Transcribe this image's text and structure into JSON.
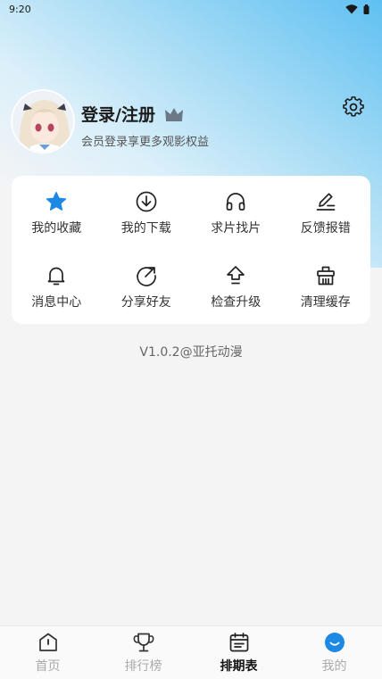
{
  "status_bar": {
    "time": "9:20"
  },
  "profile": {
    "title": "登录/注册",
    "subtitle": "会员登录享更多观影权益"
  },
  "grid": [
    {
      "label": "我的收藏",
      "icon": "star-icon"
    },
    {
      "label": "我的下载",
      "icon": "download-icon"
    },
    {
      "label": "求片找片",
      "icon": "headphones-icon"
    },
    {
      "label": "反馈报错",
      "icon": "edit-icon"
    },
    {
      "label": "消息中心",
      "icon": "bell-icon"
    },
    {
      "label": "分享好友",
      "icon": "share-icon"
    },
    {
      "label": "检查升级",
      "icon": "upgrade-icon"
    },
    {
      "label": "清理缓存",
      "icon": "basket-icon"
    }
  ],
  "version": "V1.0.2@亚托动漫",
  "tabs": [
    {
      "label": "首页",
      "icon": "home-icon"
    },
    {
      "label": "排行榜",
      "icon": "trophy-icon"
    },
    {
      "label": "排期表",
      "icon": "calendar-icon"
    },
    {
      "label": "我的",
      "icon": "profile-icon"
    }
  ],
  "colors": {
    "accent": "#1e88e5",
    "hero_top": "#5fc0f2",
    "background": "#f4f4f5"
  }
}
